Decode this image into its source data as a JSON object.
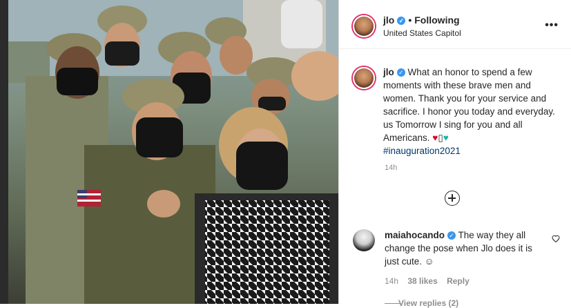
{
  "post": {
    "username": "jlo",
    "following_label": "Following",
    "location": "United States Capitol",
    "more_label": "•••"
  },
  "caption": {
    "username": "jlo",
    "text": "What an honor to spend a few moments with these brave men and women. Thank you for your service and sacrifice. I honor you today and everyday. us Tomorrow I sing for you and all Americans.",
    "emojis_heart": "♥",
    "emojis_box": "▯",
    "emojis_teal": "♥",
    "hashtag": "#inauguration2021",
    "time": "14h"
  },
  "comment": {
    "username": "maiahocando",
    "text": "The way they all change the pose when Jlo does it is just cute. ☺",
    "time": "14h",
    "likes": "38 likes",
    "reply_label": "Reply",
    "view_replies": "View replies (2)"
  },
  "colors": {
    "verified": "#3897f0",
    "link": "#00376b",
    "muted": "#8e8e8e"
  }
}
